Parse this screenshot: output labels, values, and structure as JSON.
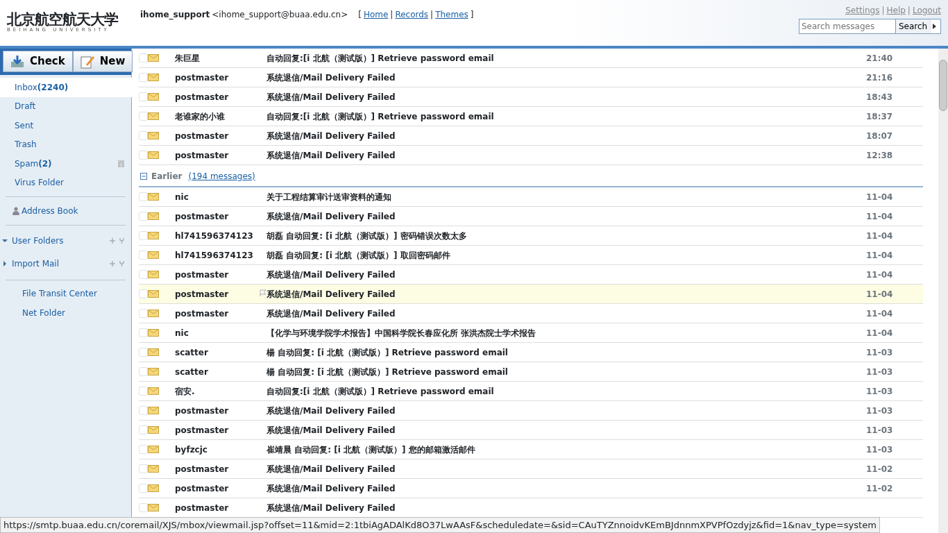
{
  "logo": {
    "title": "北京航空航天大学",
    "subtitle": "BEIHANG UNIVERSITY"
  },
  "user": {
    "name": "ihome_support",
    "email": "<ihome_support@buaa.edu.cn>"
  },
  "top_links": [
    "Home",
    "Records",
    "Themes"
  ],
  "link_brackets": [
    "[",
    "]"
  ],
  "link_separator": "|",
  "account_links": [
    "Settings",
    "Help",
    "Logout"
  ],
  "search": {
    "placeholder": "Search messages",
    "button": "Search"
  },
  "toolbar": [
    "Check",
    "New"
  ],
  "folders": [
    {
      "label": "Inbox",
      "count": "(2240)",
      "selected": true
    },
    {
      "label": "Draft",
      "selected": false
    },
    {
      "label": "Sent",
      "selected": false
    },
    {
      "label": "Trash",
      "selected": false
    },
    {
      "label": "Spam",
      "count": "(2)",
      "selected": false,
      "clearable": true
    },
    {
      "label": "Virus Folder",
      "selected": false
    }
  ],
  "address_book": "Address Book",
  "folder_groups": [
    {
      "label": "User Folders",
      "expanded": true
    },
    {
      "label": "Import Mail",
      "expanded": false
    }
  ],
  "tools": [
    "File Transit Center",
    "Net Folder"
  ],
  "groups": [
    {
      "messages": [
        {
          "sender": "朱巨星",
          "subject": "自动回复:[i 北航（测试版）] Retrieve password email",
          "date": "21:40",
          "highlighted": false
        },
        {
          "sender": "postmaster",
          "subject": "系统退信/Mail Delivery Failed",
          "date": "21:16",
          "highlighted": false
        },
        {
          "sender": "postmaster",
          "subject": "系统退信/Mail Delivery Failed",
          "date": "18:43",
          "highlighted": false
        },
        {
          "sender": "老谁家的小谁",
          "subject": "自动回复:[i 北航（测试版）] Retrieve password email",
          "date": "18:37",
          "highlighted": false
        },
        {
          "sender": "postmaster",
          "subject": "系统退信/Mail Delivery Failed",
          "date": "18:07",
          "highlighted": false
        },
        {
          "sender": "postmaster",
          "subject": "系统退信/Mail Delivery Failed",
          "date": "12:38",
          "highlighted": false
        }
      ]
    },
    {
      "title": "Earlier",
      "count": "(194 messages)",
      "expanded": true,
      "messages": [
        {
          "sender": "nic",
          "subject": "关于工程结算审计送审资料的通知",
          "date": "11-04",
          "highlighted": false
        },
        {
          "sender": "postmaster",
          "subject": "系统退信/Mail Delivery Failed",
          "date": "11-04",
          "highlighted": false
        },
        {
          "sender": "hl741596374123",
          "subject": "胡磊 自动回复: [i 北航（测试版）] 密码错误次数太多",
          "date": "11-04",
          "highlighted": false
        },
        {
          "sender": "hl741596374123",
          "subject": "胡磊 自动回复: [i 北航（测试版）] 取回密码邮件",
          "date": "11-04",
          "highlighted": false
        },
        {
          "sender": "postmaster",
          "subject": "系统退信/Mail Delivery Failed",
          "date": "11-04",
          "highlighted": false
        },
        {
          "sender": "postmaster",
          "subject": "系统退信/Mail Delivery Failed",
          "date": "11-04",
          "highlighted": true
        },
        {
          "sender": "postmaster",
          "subject": "系统退信/Mail Delivery Failed",
          "date": "11-04",
          "highlighted": false
        },
        {
          "sender": "nic",
          "subject": "【化学与环境学院学术报告】中国科学院长春应化所 张洪杰院士学术报告",
          "date": "11-04",
          "highlighted": false
        },
        {
          "sender": "scatter",
          "subject": "楊 自动回复: [i 北航（测试版）] Retrieve password email",
          "date": "11-03",
          "highlighted": false
        },
        {
          "sender": "scatter",
          "subject": "楊 自动回复: [i 北航（测试版）] Retrieve password email",
          "date": "11-03",
          "highlighted": false
        },
        {
          "sender": "宿安.",
          "subject": "自动回复:[i 北航（测试版）] Retrieve password email",
          "date": "11-03",
          "highlighted": false
        },
        {
          "sender": "postmaster",
          "subject": "系统退信/Mail Delivery Failed",
          "date": "11-03",
          "highlighted": false
        },
        {
          "sender": "postmaster",
          "subject": "系统退信/Mail Delivery Failed",
          "date": "11-03",
          "highlighted": false
        },
        {
          "sender": "byfzcjc",
          "subject": "崔靖晨 自动回复: [i 北航（测试版）] 您的邮箱激活邮件",
          "date": "11-03",
          "highlighted": false
        },
        {
          "sender": "postmaster",
          "subject": "系统退信/Mail Delivery Failed",
          "date": "11-02",
          "highlighted": false
        },
        {
          "sender": "postmaster",
          "subject": "系统退信/Mail Delivery Failed",
          "date": "11-02",
          "highlighted": false
        },
        {
          "sender": "postmaster",
          "subject": "系统退信/Mail Delivery Failed",
          "highlighted": false
        }
      ]
    }
  ],
  "status_bar": "https://smtp.buaa.edu.cn/coremail/XJS/mbox/viewmail.jsp?offset=11&mid=2:1tbiAgADAlKd8O37LwAAsF&scheduledate=&sid=CAuTYZnnoidvKEmBJdnnmXPVPfOzdyjz&fid=1&nav_type=system"
}
